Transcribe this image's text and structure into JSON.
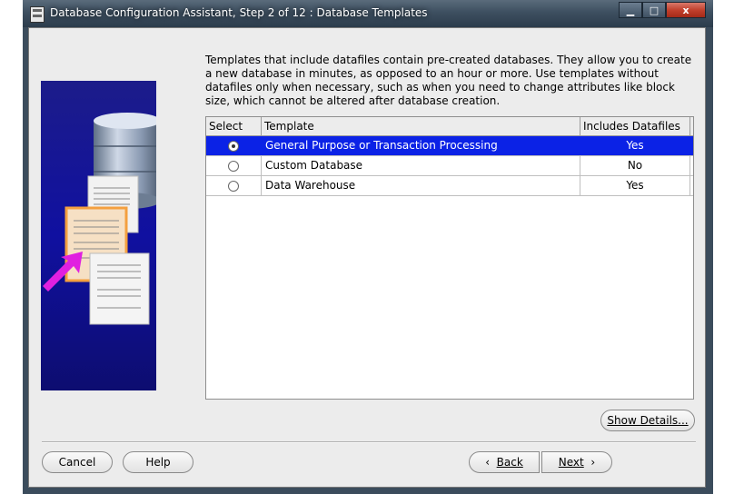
{
  "window": {
    "title": "Database Configuration Assistant, Step 2 of 12 : Database Templates",
    "minimize": "▁",
    "maximize": "□",
    "close": "x"
  },
  "description": "Templates that include datafiles contain pre-created databases. They allow you to create a new database in minutes, as opposed to an hour or more. Use templates without datafiles only when necessary, such as when you need to change attributes like block size, which cannot be altered after database creation.",
  "table": {
    "headers": [
      "Select",
      "Template",
      "Includes Datafiles"
    ],
    "rows": [
      {
        "template": "General Purpose or Transaction Processing",
        "datafiles": "Yes",
        "selected": true
      },
      {
        "template": "Custom Database",
        "datafiles": "No",
        "selected": false
      },
      {
        "template": "Data Warehouse",
        "datafiles": "Yes",
        "selected": false
      }
    ]
  },
  "buttons": {
    "show_details": "Show Details...",
    "cancel": "Cancel",
    "help": "Help",
    "back": "Back",
    "next": "Next"
  },
  "colors": {
    "selection": "#0b22e6",
    "art_panel": "#1010a0",
    "arrow": "#e020e0"
  }
}
